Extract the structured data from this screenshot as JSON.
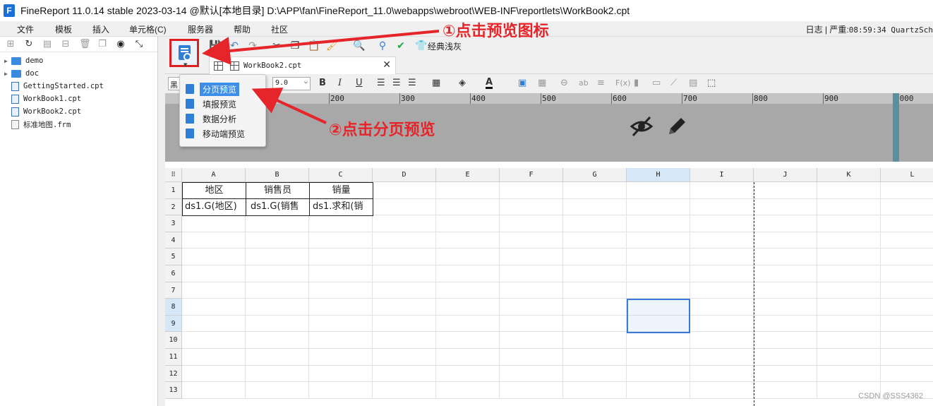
{
  "window": {
    "title": "FineReport 11.0.14 stable 2023-03-14 @默认[本地目录]    D:\\APP\\fan\\FineReport_11.0\\webapps\\webroot\\WEB-INF\\reportlets\\WorkBook2.cpt"
  },
  "menu": {
    "items": [
      "文件",
      "模板",
      "插入",
      "单元格(C)",
      "服务器",
      "帮助",
      "社区"
    ],
    "right_log": "日志",
    "right_level": "严重",
    "right_time": "08:59:34 QuartzSch"
  },
  "sidebar": {
    "items": [
      {
        "label": "demo",
        "type": "folder"
      },
      {
        "label": "doc",
        "type": "folder"
      },
      {
        "label": "GettingStarted.cpt",
        "type": "cpt"
      },
      {
        "label": "WorkBook1.cpt",
        "type": "cpt"
      },
      {
        "label": "WorkBook2.cpt",
        "type": "cpt"
      },
      {
        "label": "标准地图.frm",
        "type": "frm"
      }
    ]
  },
  "toolbar": {
    "classic_label": "经典浅灰"
  },
  "tab": {
    "label": "WorkBook2.cpt"
  },
  "format": {
    "font_name": "黑",
    "font_size": "9.0"
  },
  "preview_menu": {
    "items": [
      "分页预览",
      "填报预览",
      "数据分析",
      "移动端预览"
    ],
    "selected": "分页预览"
  },
  "ruler": {
    "labels": [
      "200",
      "300",
      "400",
      "500",
      "600",
      "700",
      "800",
      "900",
      "1000"
    ]
  },
  "sheet": {
    "columns": [
      "A",
      "B",
      "C",
      "D",
      "E",
      "F",
      "G",
      "H",
      "I",
      "J",
      "K",
      "L"
    ],
    "rows": [
      "1",
      "2",
      "3",
      "4",
      "5",
      "6",
      "7",
      "8",
      "9",
      "10",
      "11",
      "12",
      "13"
    ],
    "selected_column": "H",
    "selected_rows": [
      "8",
      "9"
    ],
    "header_cells": [
      "地区",
      "销售员",
      "销量"
    ],
    "data_cells": [
      "ds1.G(地区)",
      "ds1.G(销售",
      "ds1.求和(销"
    ]
  },
  "annotations": {
    "step1": "①点击预览图标",
    "step2": "②点击分页预览"
  },
  "watermark": "CSDN @SSS4362",
  "colors": {
    "annotation_red": "#e5252a",
    "selection_blue": "#3a7bd5",
    "menu_selected": "#3d8ee8",
    "brand_blue": "#2f7fd6"
  }
}
